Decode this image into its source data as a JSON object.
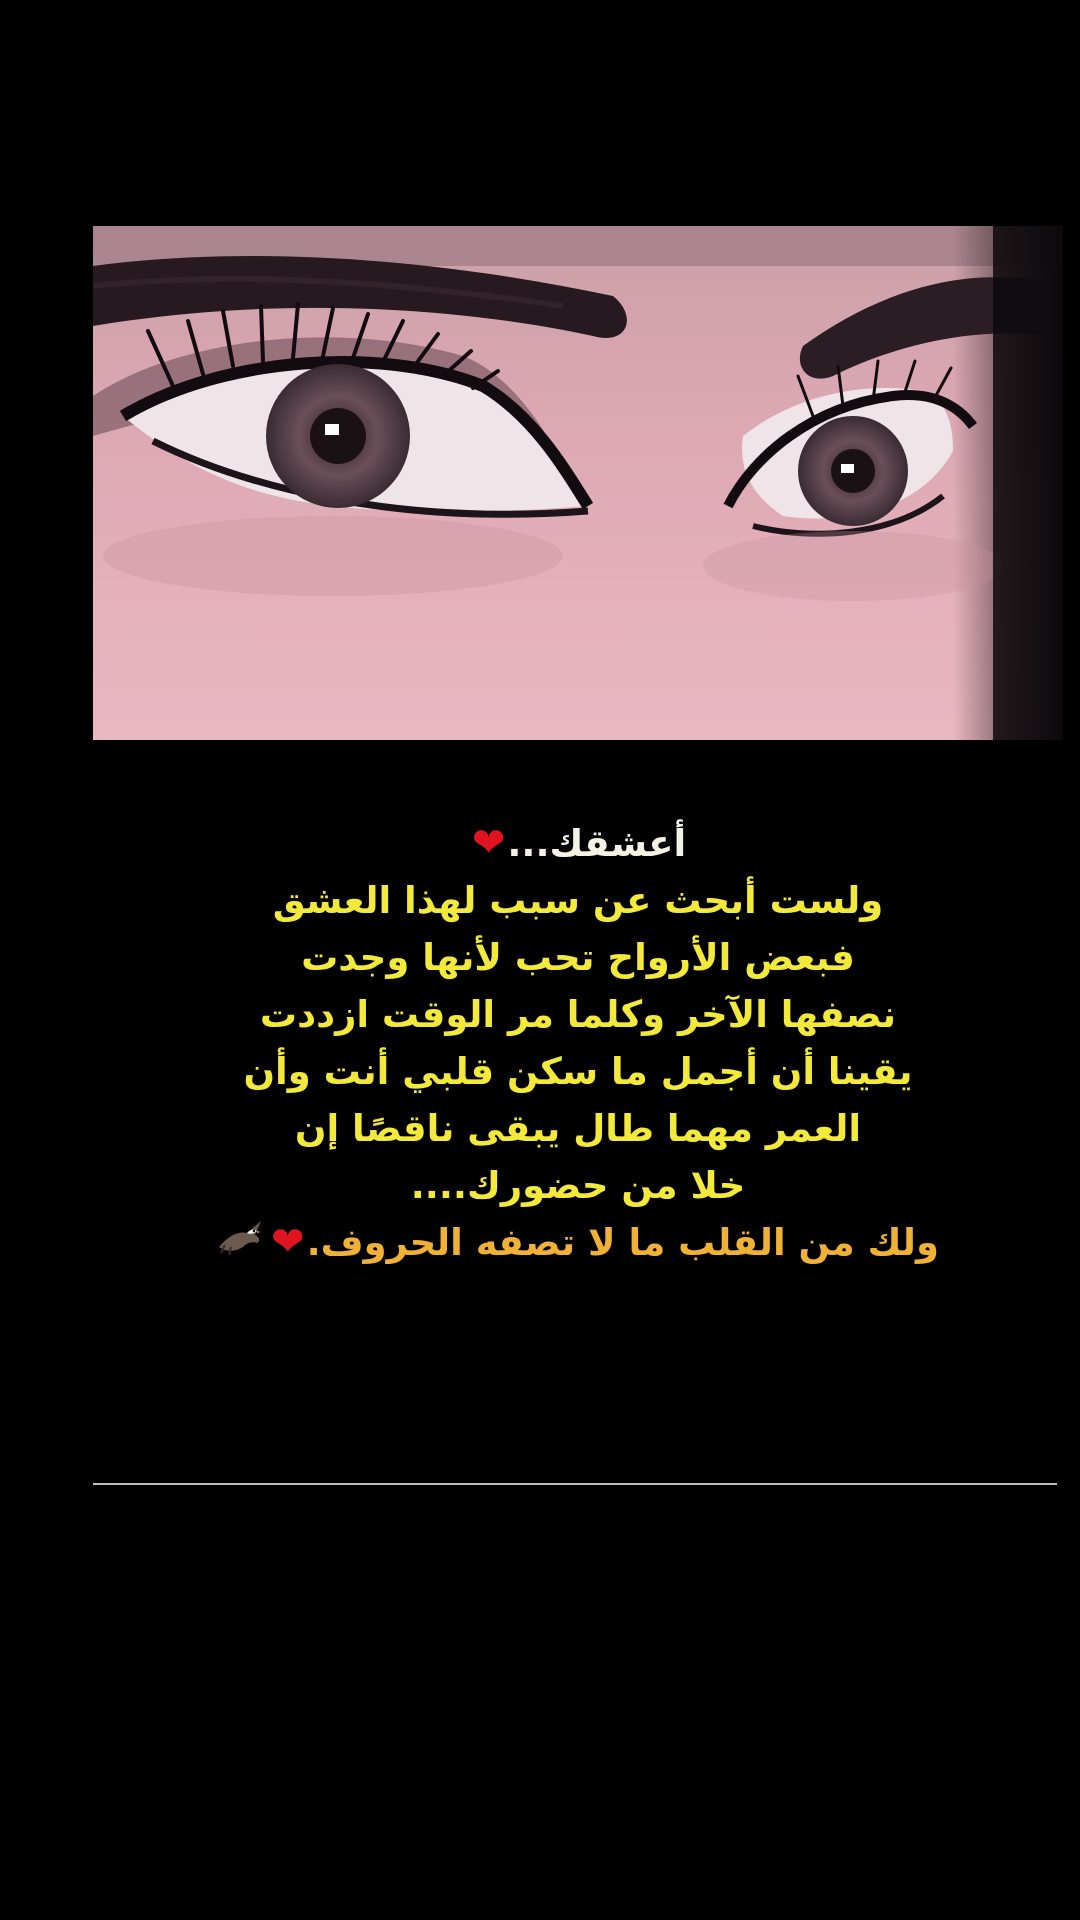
{
  "post": {
    "lines": [
      "أعشقك...",
      "ولست أبحث عن سبب لهذا العشق",
      "فبعض الأرواح تحب لأنها وجدت",
      "نصفها الآخر وكلما مر الوقت ازددت",
      "يقينا أن أجمل ما سكن قلبي أنت وأن",
      "العمر مهما طال يبقى ناقصًا إن",
      "خلا من حضورك....",
      "ولك من القلب ما لا تصفه الحروف."
    ],
    "heart_glyph": "❤",
    "colors": {
      "first_line": "#f4f2e4",
      "body_text": "#f2e93a",
      "last_line": "#f0b135",
      "heart": "#e0141f",
      "background": "#000000",
      "divider": "#bdbdbd"
    }
  }
}
